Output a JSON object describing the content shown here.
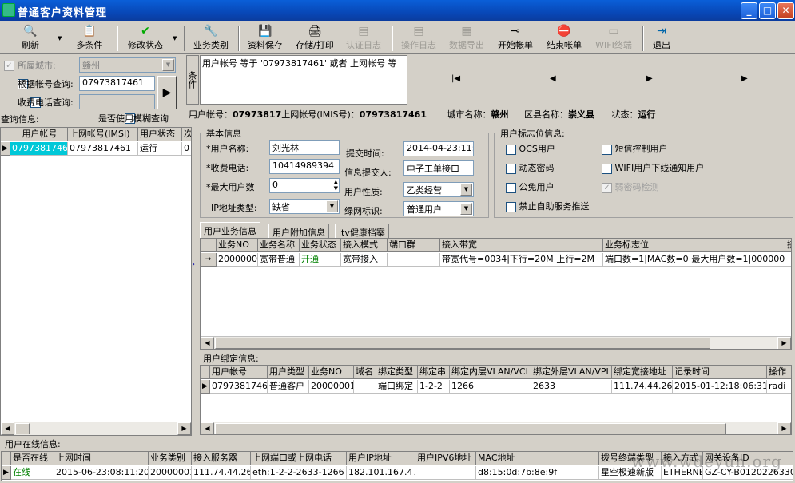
{
  "window": {
    "title": "普通客户资料管理",
    "min": "_",
    "max": "□",
    "close": "✕"
  },
  "toolbar": [
    {
      "label": "刷新",
      "icon": "🔍",
      "enabled": true
    },
    {
      "label": "多条件",
      "icon": "📋",
      "enabled": true
    },
    {
      "label": "修改状态",
      "icon": "✔",
      "enabled": true
    },
    {
      "label": "业务类别",
      "icon": "🔧",
      "enabled": true
    },
    {
      "label": "资料保存",
      "icon": "💾",
      "enabled": true
    },
    {
      "label": "存储/打印",
      "icon": "🖨",
      "enabled": true
    },
    {
      "label": "认证日志",
      "icon": "▤",
      "enabled": false
    },
    {
      "label": "操作日志",
      "icon": "▤",
      "enabled": false
    },
    {
      "label": "数据导出",
      "icon": "▦",
      "enabled": false
    },
    {
      "label": "开始帐单",
      "icon": "⊸",
      "enabled": true
    },
    {
      "label": "结束帐单",
      "icon": "⛔",
      "enabled": true
    },
    {
      "label": "WIFI终端",
      "icon": "▭",
      "enabled": false
    },
    {
      "label": "退出",
      "icon": "⇥",
      "enabled": true
    }
  ],
  "query": {
    "city_label": "所属城市:",
    "city_value": "赣州",
    "acct_label": "根据帐号查询:",
    "acct_value": "07973817461",
    "phone_label": "收费电话查询:",
    "phone_value": "",
    "go": "▶",
    "info_label": "查询信息:",
    "fuzzy_label": "是否使用模糊查询",
    "cond_label": "条件",
    "cond_text": "用户帐号 等于 '07973817461' 或者 上网帐号 等"
  },
  "nav": {
    "first": "|◀",
    "prev": "◀",
    "next": "▶",
    "last": "▶|"
  },
  "summary": {
    "acct_label": "用户帐号：",
    "acct": "07973817",
    "imsi_label": "上网帐号(IMIS号)：",
    "imsi": "07973817461",
    "city_label": "城市名称：",
    "city": "赣州",
    "county_label": "区县名称：",
    "county": "崇义县",
    "state_label": "状态：",
    "state": "运行"
  },
  "left_grid": {
    "headers": [
      "用户帐号",
      "上网帐号(IMSI)",
      "用户状态",
      "次"
    ],
    "rows": [
      [
        "07973817461",
        "07973817461",
        "运行",
        "0"
      ]
    ]
  },
  "basic": {
    "title": "基本信息",
    "name_label": "*用户名称:",
    "name": "刘光林",
    "phone_label": "*收费电话:",
    "phone": "10414989394",
    "max_label": "*最大用户数",
    "max": "0",
    "ip_label": "IP地址类型:",
    "ip": "缺省",
    "submit_time_label": "提交时间:",
    "submit_time": "2014-04-23:11:",
    "submitter_label": "信息提交人:",
    "submitter": "电子工单接口",
    "nature_label": "用户性质:",
    "nature": "乙类经营",
    "green_label": "绿网标识:",
    "green": "普通用户"
  },
  "flags": {
    "title": "用户标志位信息:",
    "items": [
      {
        "label": "OCS用户",
        "checked": false,
        "disabled": false
      },
      {
        "label": "短信控制用户",
        "checked": false,
        "disabled": false
      },
      {
        "label": "动态密码",
        "checked": false,
        "disabled": false
      },
      {
        "label": "WIFI用户下线通知用户",
        "checked": false,
        "disabled": false
      },
      {
        "label": "公免用户",
        "checked": false,
        "disabled": false
      },
      {
        "label": "弱密码检测",
        "checked": true,
        "disabled": true
      },
      {
        "label": "禁止自助服务推送",
        "checked": false,
        "disabled": false
      }
    ]
  },
  "tabs": [
    "用户业务信息",
    "用户附加信息",
    "itv健康档案"
  ],
  "service_grid": {
    "headers": [
      "业务NO",
      "业务名称",
      "业务状态",
      "接入模式",
      "端口群",
      "接入带宽",
      "业务标志位",
      "接"
    ],
    "rows": [
      [
        "20000001",
        "宽带普通",
        "开通",
        "宽带接入",
        "",
        "带宽代号=0034|下行=20M|上行=2M",
        "端口数=1|MAC数=0|最大用户数=1|0000001",
        ""
      ]
    ]
  },
  "bind": {
    "title": "用户绑定信息:",
    "headers": [
      "用户帐号",
      "用户类型",
      "业务NO",
      "域名",
      "绑定类型",
      "绑定串",
      "绑定内层VLAN/VCI",
      "绑定外层VLAN/VPI",
      "绑定宽接地址",
      "记录时间",
      "操作"
    ],
    "rows": [
      [
        "07973817461",
        "普通客户",
        "20000001",
        "",
        "端口绑定",
        "1-2-2",
        "1266",
        "2633",
        "111.74.44.26",
        "2015-01-12:18:06:31",
        "radi"
      ]
    ]
  },
  "online": {
    "title": "用户在线信息:",
    "headers": [
      "是否在线",
      "上网时间",
      "业务类别",
      "接入服务器",
      "上网端口或上网电话",
      "用户IP地址",
      "用户IPV6地址",
      "MAC地址",
      "拨号终端类型",
      "接入方式",
      "网关设备ID"
    ],
    "rows": [
      [
        "在线",
        "2015-06-23:08:11:20",
        "20000001",
        "111.74.44.26",
        "eth:1-2-2-2633-1266",
        "182.101.167.47",
        "",
        "d8:15:0d:7b:8e:9f",
        "星空极速新版",
        "ETHERNET",
        "GZ-CY-B01202263301"
      ]
    ]
  },
  "watermark": "www.wdeyun.org"
}
